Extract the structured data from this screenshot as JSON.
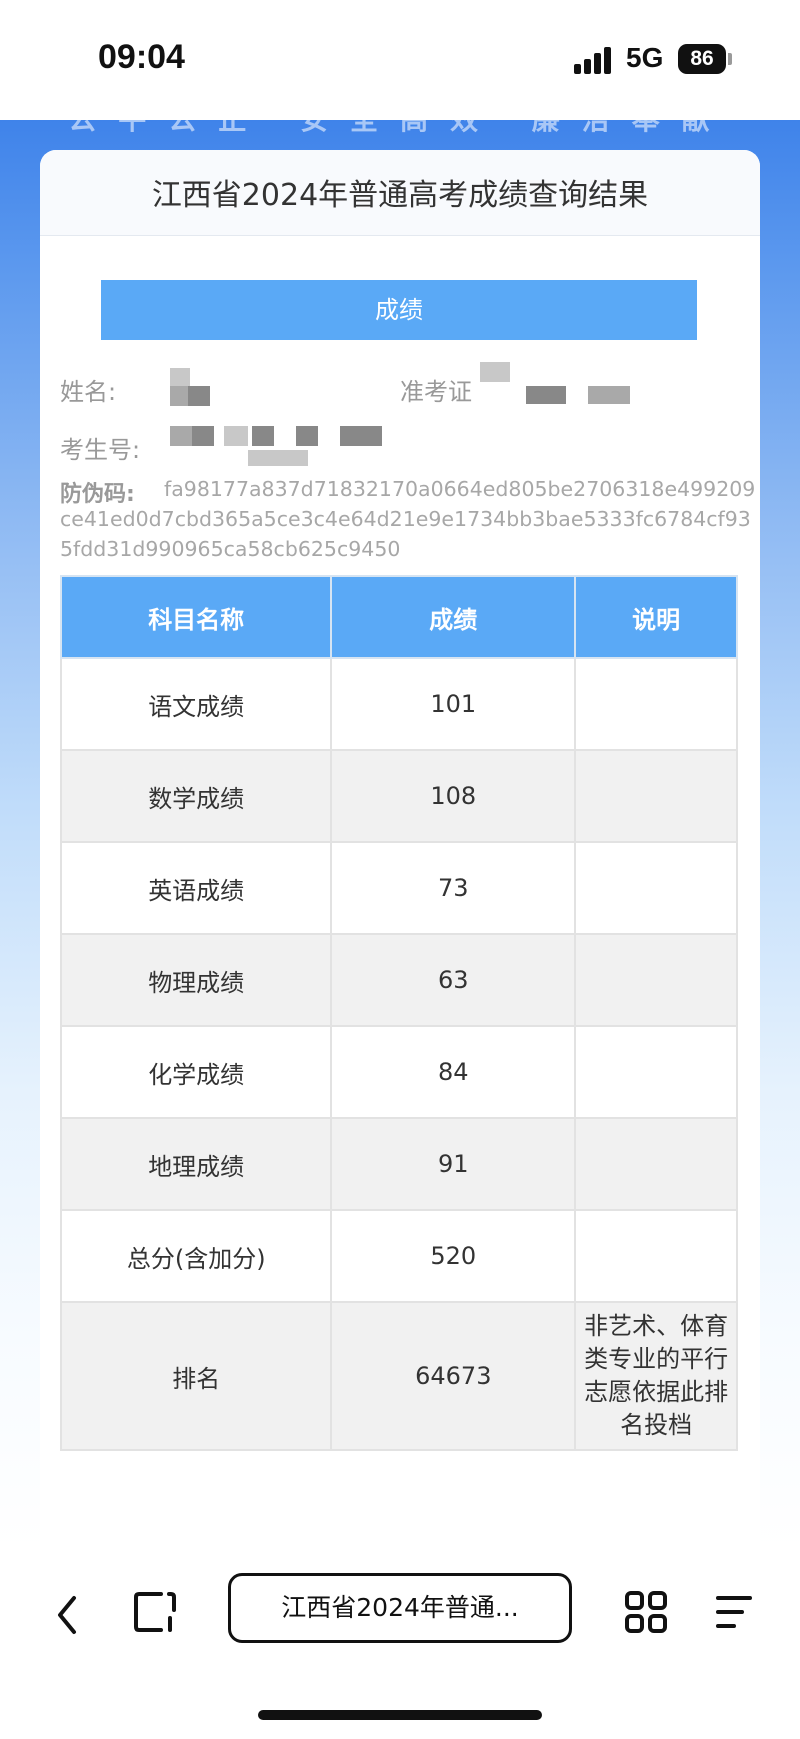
{
  "status_bar": {
    "time": "09:04",
    "network": "5G",
    "battery": "86"
  },
  "page": {
    "slogan": "公平公正 安全高效 廉洁奉献",
    "title": "江西省2024年普通高考成绩查询结果",
    "banner": "成绩",
    "name_label": "姓名:",
    "ticket_label": "准考证",
    "exam_no_label": "考生号:",
    "anti_fake_label": "防伪码:",
    "anti_fake_code": "fa98177a837d71832170a0664ed805be2706318e499209ce41ed0d7cbd365a5ce3c4e64d21e9e1734bb3bae5333fc6784cf935fdd31d990965ca58cb625c9450"
  },
  "table": {
    "headers": [
      "科目名称",
      "成绩",
      "说明"
    ],
    "rows": [
      {
        "subject": "语文成绩",
        "score": "101",
        "note": ""
      },
      {
        "subject": "数学成绩",
        "score": "108",
        "note": ""
      },
      {
        "subject": "英语成绩",
        "score": "73",
        "note": ""
      },
      {
        "subject": "物理成绩",
        "score": "63",
        "note": ""
      },
      {
        "subject": "化学成绩",
        "score": "84",
        "note": ""
      },
      {
        "subject": "地理成绩",
        "score": "91",
        "note": ""
      },
      {
        "subject": "总分(含加分)",
        "score": "520",
        "note": ""
      },
      {
        "subject": "排名",
        "score": "64673",
        "note": "非艺术、体育类专业的平行志愿依据此排名投档"
      }
    ]
  },
  "browser": {
    "url_label": "江西省2024年普通..."
  }
}
